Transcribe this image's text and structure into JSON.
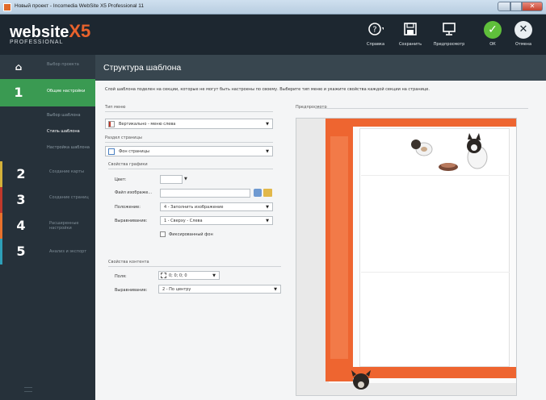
{
  "window": {
    "title": "Новый проект - Incomedia WebSite X5 Professional 11"
  },
  "logo": {
    "brand": "website",
    "x5": "X5",
    "edition": "PROFESSIONAL"
  },
  "toolbar": {
    "help": "Справка",
    "save": "Сохранить",
    "preview": "Предпросмотр",
    "ok": "ОК",
    "cancel": "Отмена"
  },
  "sidebar": {
    "home_label": "Выбор проекта",
    "steps": [
      {
        "num": "1",
        "label": "Общие настройки"
      },
      {
        "num": "2",
        "label": "Создание карты"
      },
      {
        "num": "3",
        "label": "Создание страниц"
      },
      {
        "num": "4",
        "label": "Расширенные настройки"
      },
      {
        "num": "5",
        "label": "Анализ и экспорт"
      }
    ],
    "substeps": [
      {
        "label": "Выбор шаблона"
      },
      {
        "label": "Стиль шаблона"
      },
      {
        "label": "Настройка шаблона"
      }
    ]
  },
  "main": {
    "title": "Структура шаблона",
    "description": "Слой шаблона поделен на секции, которые не могут быть настроены по своему. Выберите тип меню и укажите свойства каждой секции на странице.",
    "menu_type": {
      "label": "Тип меню",
      "value": "Вертикально - меню слева"
    },
    "page_section": {
      "label": "Раздел страницы",
      "value": "Фон страницы"
    },
    "graphics": {
      "label": "Свойства графики",
      "color_label": "Цвет:",
      "file_label": "Файл изображе...",
      "position_label": "Положение:",
      "position_value": "4 - Заполнить изображение",
      "align_label": "Выравнивание:",
      "align_value": "1 - Сверху - Слева",
      "fixed_bg_label": "Фиксированный фон"
    },
    "content": {
      "label": "Свойства контента",
      "margins_label": "Поля:",
      "margins_value": "0; 0; 0; 0",
      "align_label": "Выравнивание:",
      "align_value": "2 - По центру"
    },
    "preview_label": "Предпросмотр"
  },
  "colors": {
    "accent_green": "#3a9a52",
    "orange": "#ee6530",
    "dark_header": "#1d2730"
  }
}
